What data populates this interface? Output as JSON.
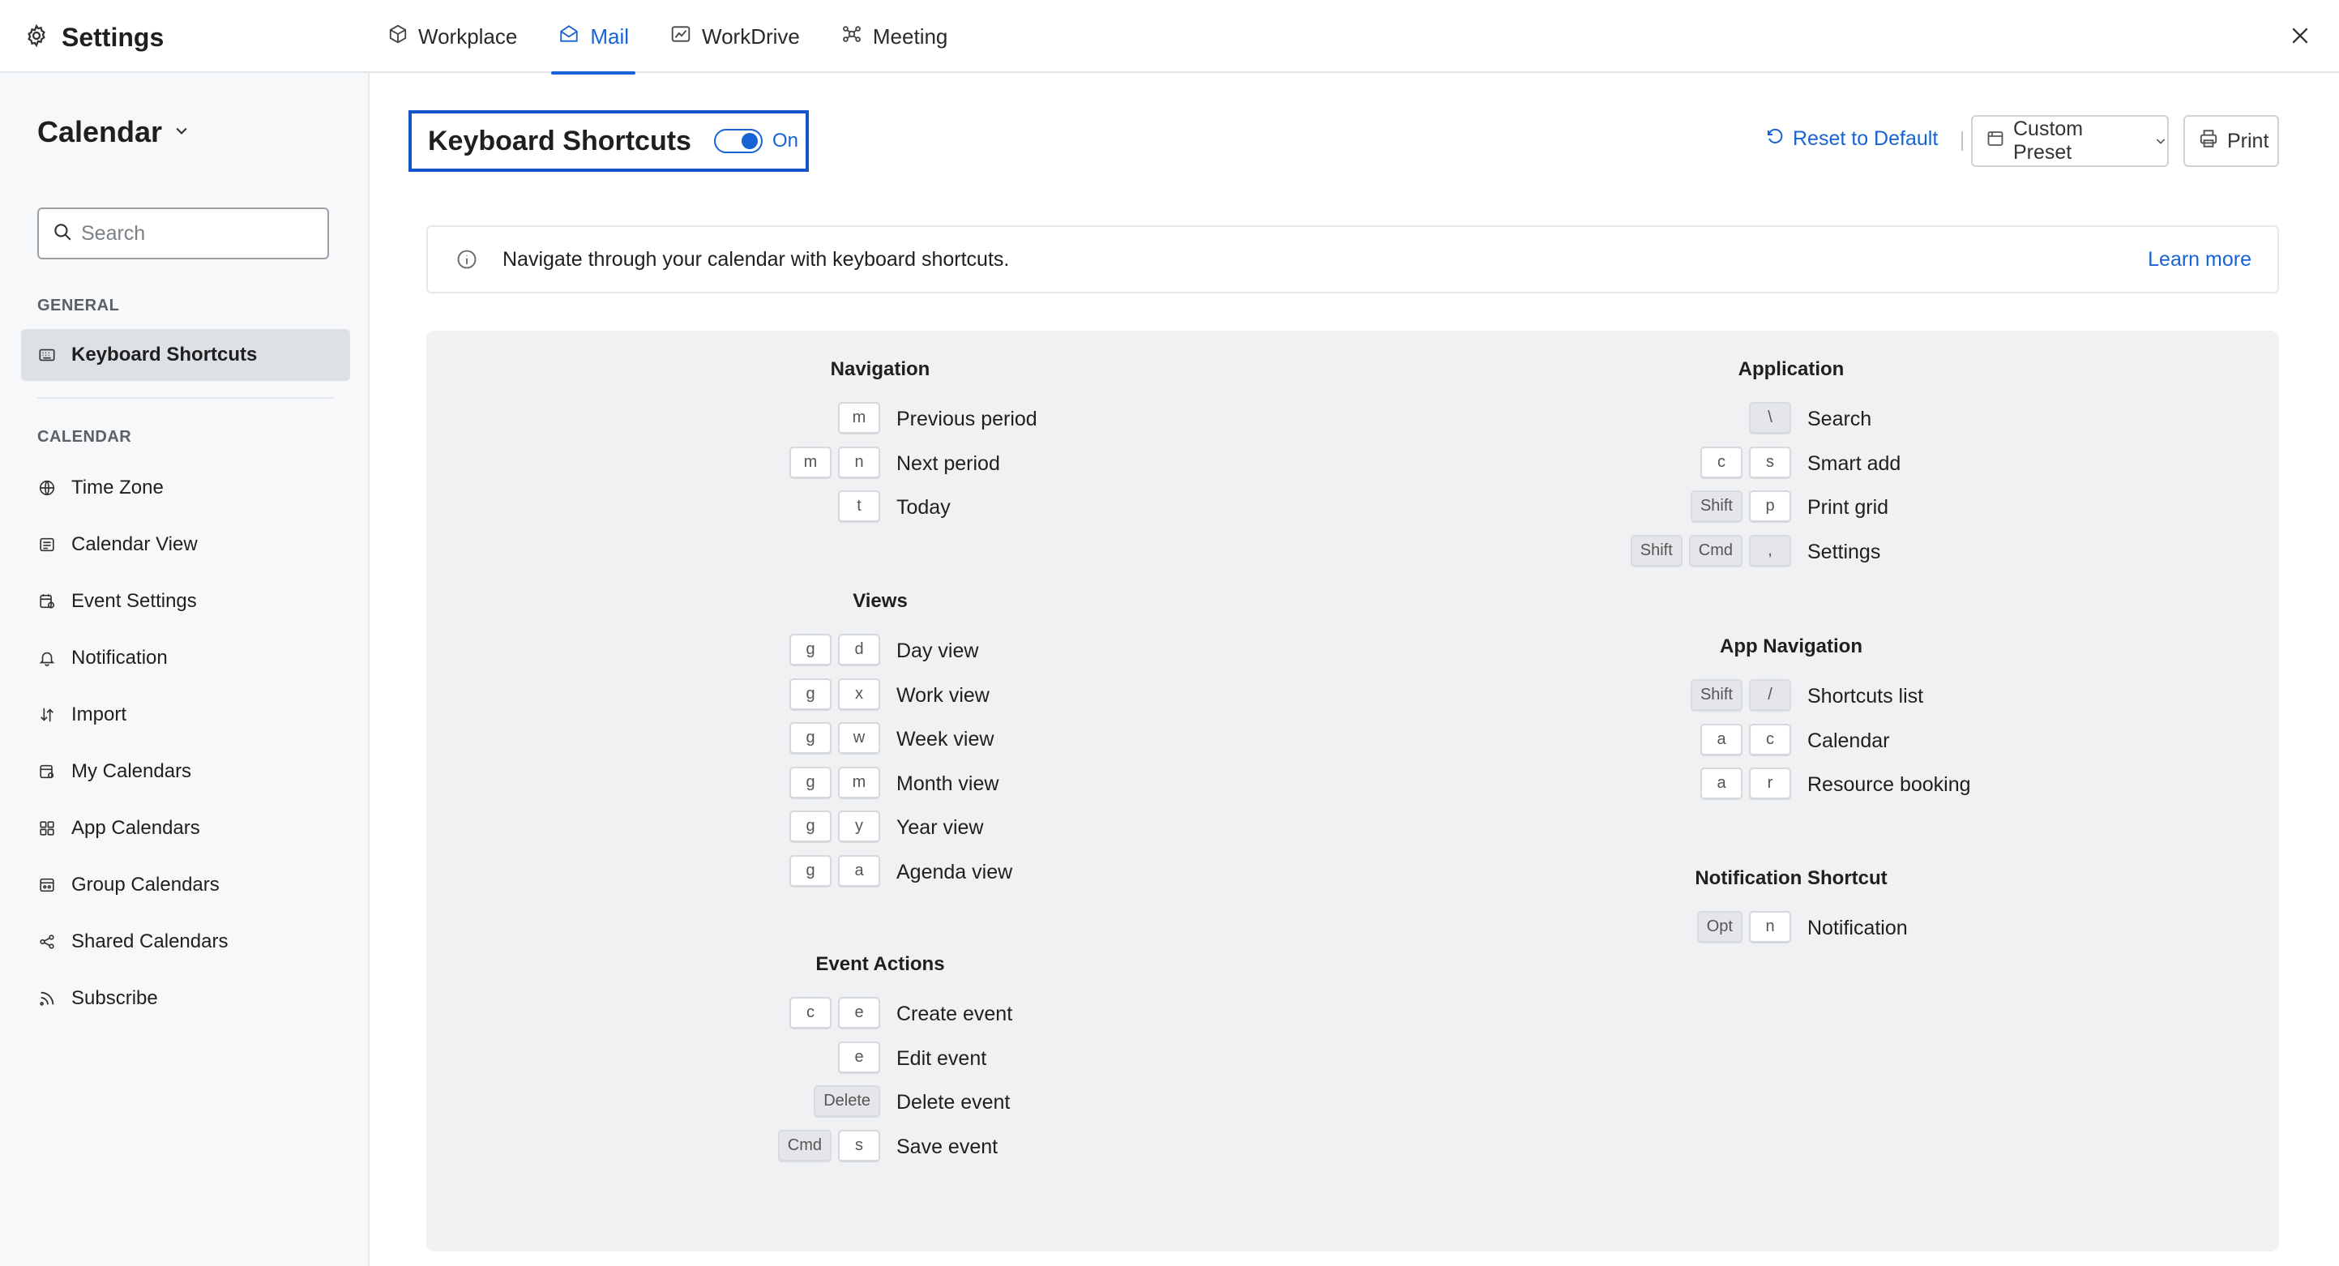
{
  "topbar": {
    "title": "Settings",
    "tabs": [
      {
        "label": "Workplace",
        "icon": "cube-icon"
      },
      {
        "label": "Mail",
        "icon": "mail-icon"
      },
      {
        "label": "WorkDrive",
        "icon": "drive-icon"
      },
      {
        "label": "Meeting",
        "icon": "meeting-icon"
      }
    ],
    "active_tab": "Mail"
  },
  "sidebar": {
    "module": "Calendar",
    "search_placeholder": "Search",
    "general_label": "GENERAL",
    "general_items": [
      {
        "label": "Keyboard Shortcuts",
        "icon": "keyboard-icon",
        "active": true
      }
    ],
    "calendar_label": "CALENDAR",
    "calendar_items": [
      {
        "label": "Time Zone",
        "icon": "globe-icon"
      },
      {
        "label": "Calendar View",
        "icon": "calendar-view-icon"
      },
      {
        "label": "Event Settings",
        "icon": "event-settings-icon"
      },
      {
        "label": "Notification",
        "icon": "bell-icon"
      },
      {
        "label": "Import",
        "icon": "import-icon"
      },
      {
        "label": "My Calendars",
        "icon": "my-calendars-icon"
      },
      {
        "label": "App Calendars",
        "icon": "app-calendars-icon"
      },
      {
        "label": "Group Calendars",
        "icon": "group-calendars-icon"
      },
      {
        "label": "Shared Calendars",
        "icon": "share-icon"
      },
      {
        "label": "Subscribe",
        "icon": "rss-icon"
      }
    ]
  },
  "header": {
    "title": "Keyboard Shortcuts",
    "toggle_label": "On",
    "toggle_on": true,
    "reset_label": "Reset to Default",
    "preset_label": "Custom Preset",
    "print_label": "Print"
  },
  "info": {
    "text": "Navigate through your calendar with keyboard shortcuts.",
    "link": "Learn more"
  },
  "shortcuts": {
    "navigation": {
      "title": "Navigation",
      "items": [
        {
          "keys": [
            "m"
          ],
          "action": "Previous period"
        },
        {
          "keys": [
            "m",
            "n"
          ],
          "action": "Next period"
        },
        {
          "keys": [
            "t"
          ],
          "action": "Today"
        }
      ]
    },
    "views": {
      "title": "Views",
      "items": [
        {
          "keys": [
            "g",
            "d"
          ],
          "action": "Day view"
        },
        {
          "keys": [
            "g",
            "x"
          ],
          "action": "Work view"
        },
        {
          "keys": [
            "g",
            "w"
          ],
          "action": "Week view"
        },
        {
          "keys": [
            "g",
            "m"
          ],
          "action": "Month view"
        },
        {
          "keys": [
            "g",
            "y"
          ],
          "action": "Year view"
        },
        {
          "keys": [
            "g",
            "a"
          ],
          "action": "Agenda view"
        }
      ]
    },
    "event_actions": {
      "title": "Event Actions",
      "items": [
        {
          "keys": [
            "c",
            "e"
          ],
          "action": "Create event"
        },
        {
          "keys": [
            "e"
          ],
          "action": "Edit event"
        },
        {
          "keys": [
            "Delete"
          ],
          "action": "Delete event"
        },
        {
          "keys": [
            "Cmd",
            "s"
          ],
          "action": "Save event"
        }
      ]
    },
    "application": {
      "title": "Application",
      "items": [
        {
          "keys": [
            "\\"
          ],
          "action": "Search"
        },
        {
          "keys": [
            "c",
            "s"
          ],
          "action": "Smart add"
        },
        {
          "keys": [
            "Shift",
            "p"
          ],
          "action": "Print grid"
        },
        {
          "keys": [
            "Shift",
            "Cmd",
            ","
          ],
          "action": "Settings"
        }
      ]
    },
    "app_navigation": {
      "title": "App Navigation",
      "items": [
        {
          "keys": [
            "Shift",
            "/"
          ],
          "action": "Shortcuts list"
        },
        {
          "keys": [
            "a",
            "c"
          ],
          "action": "Calendar"
        },
        {
          "keys": [
            "a",
            "r"
          ],
          "action": "Resource booking"
        }
      ]
    },
    "notification_shortcut": {
      "title": "Notification Shortcut",
      "items": [
        {
          "keys": [
            "Opt",
            "n"
          ],
          "action": "Notification"
        }
      ]
    }
  },
  "colors": {
    "accent": "#1763d6",
    "highlight_border": "#1453c8",
    "panel_bg": "#f0f1f3",
    "sidebar_bg": "#f7f8f9"
  }
}
